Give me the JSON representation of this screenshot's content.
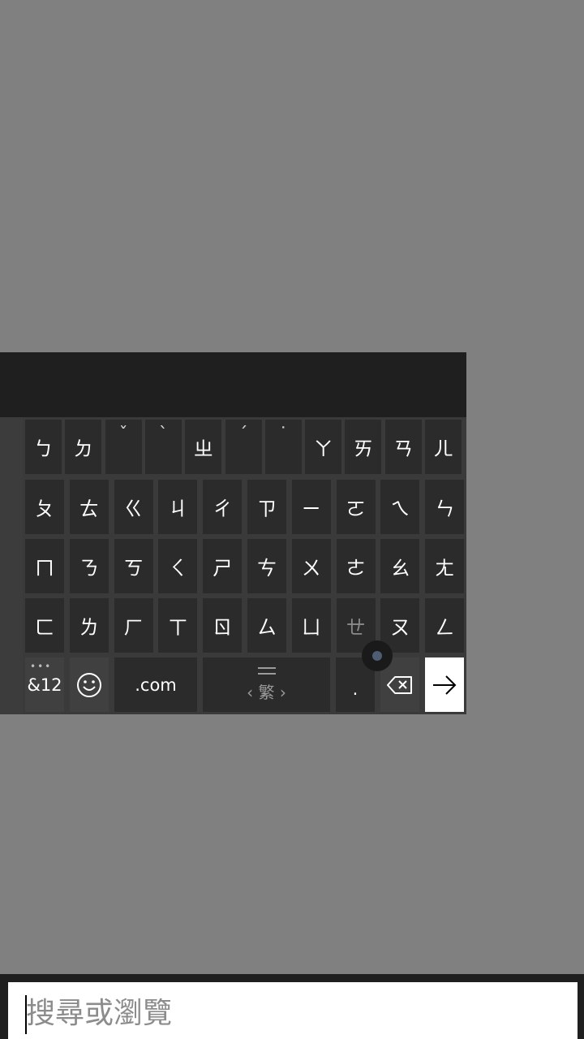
{
  "keyboard": {
    "rows": [
      [
        {
          "label": "ㄅ",
          "name": "key-bo"
        },
        {
          "label": "ㄉ",
          "name": "key-de"
        },
        {
          "label": "ˇ",
          "name": "key-tone-3",
          "tone": true
        },
        {
          "label": "ˋ",
          "name": "key-tone-4",
          "tone": true
        },
        {
          "label": "ㄓ",
          "name": "key-zhi"
        },
        {
          "label": "ˊ",
          "name": "key-tone-2",
          "tone": true
        },
        {
          "label": "˙",
          "name": "key-tone-light",
          "tone": true
        },
        {
          "label": "ㄚ",
          "name": "key-a"
        },
        {
          "label": "ㄞ",
          "name": "key-ai"
        },
        {
          "label": "ㄢ",
          "name": "key-an"
        },
        {
          "label": "ㄦ",
          "name": "key-er"
        }
      ],
      [
        {
          "label": "ㄆ",
          "name": "key-po"
        },
        {
          "label": "ㄊ",
          "name": "key-te"
        },
        {
          "label": "ㄍ",
          "name": "key-ge"
        },
        {
          "label": "ㄐ",
          "name": "key-ji"
        },
        {
          "label": "ㄔ",
          "name": "key-chi"
        },
        {
          "label": "ㄗ",
          "name": "key-zi"
        },
        {
          "label": "ㄧ",
          "name": "key-yi"
        },
        {
          "label": "ㄛ",
          "name": "key-o"
        },
        {
          "label": "ㄟ",
          "name": "key-ei"
        },
        {
          "label": "ㄣ",
          "name": "key-en"
        }
      ],
      [
        {
          "label": "ㄇ",
          "name": "key-mo"
        },
        {
          "label": "ㄋ",
          "name": "key-ne"
        },
        {
          "label": "ㄎ",
          "name": "key-ke"
        },
        {
          "label": "ㄑ",
          "name": "key-qi"
        },
        {
          "label": "ㄕ",
          "name": "key-shi"
        },
        {
          "label": "ㄘ",
          "name": "key-ci"
        },
        {
          "label": "ㄨ",
          "name": "key-wu"
        },
        {
          "label": "ㄜ",
          "name": "key-e"
        },
        {
          "label": "ㄠ",
          "name": "key-ao"
        },
        {
          "label": "ㄤ",
          "name": "key-ang"
        }
      ],
      [
        {
          "label": "ㄈ",
          "name": "key-fo"
        },
        {
          "label": "ㄌ",
          "name": "key-le"
        },
        {
          "label": "ㄏ",
          "name": "key-he"
        },
        {
          "label": "ㄒ",
          "name": "key-xi"
        },
        {
          "label": "ㄖ",
          "name": "key-ri"
        },
        {
          "label": "ㄙ",
          "name": "key-si"
        },
        {
          "label": "ㄩ",
          "name": "key-yu"
        },
        {
          "label": "ㄝ",
          "name": "key-eh",
          "dim": true
        },
        {
          "label": "ㄡ",
          "name": "key-ou"
        },
        {
          "label": "ㄥ",
          "name": "key-eng"
        }
      ]
    ],
    "bottom_row": {
      "symbols_label": "&12",
      "emoji_icon": "emoji-icon",
      "dotcom_label": ".com",
      "space_label": "‹ 繁 ›",
      "period_label": ".",
      "backspace_icon": "backspace-icon",
      "enter_icon": "arrow-right-icon"
    }
  },
  "search": {
    "placeholder": "搜尋或瀏覽"
  }
}
